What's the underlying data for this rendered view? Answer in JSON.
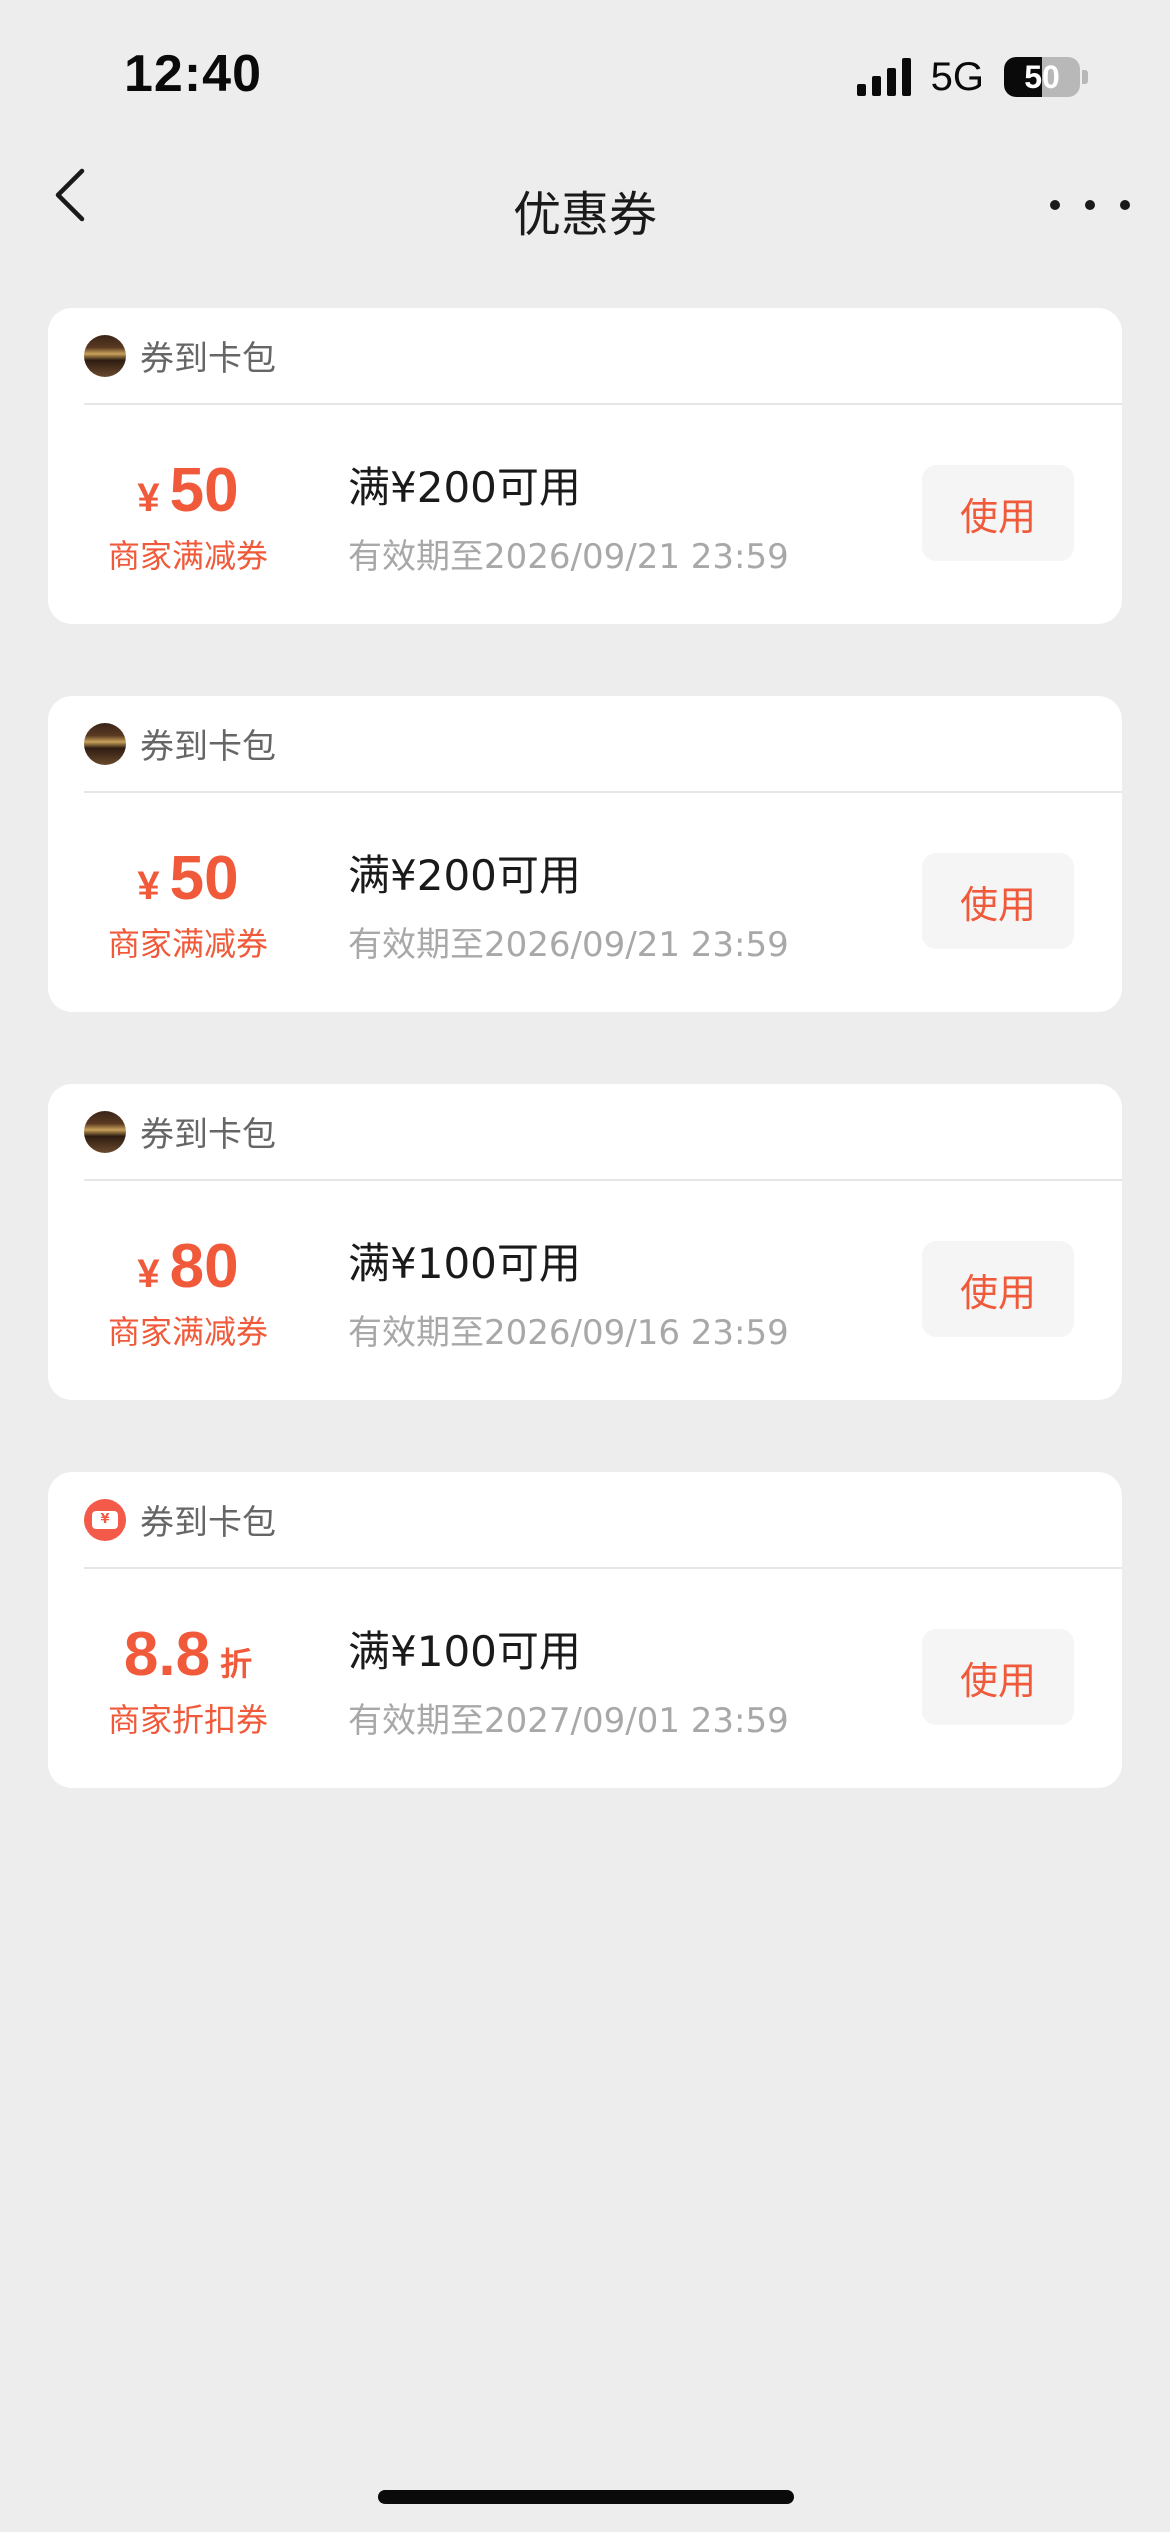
{
  "status_bar": {
    "time": "12:40",
    "network": "5G",
    "battery_level": "50",
    "battery_fraction": 0.5
  },
  "nav": {
    "back_icon": "chevron-left-icon",
    "title": "优惠券",
    "more_icon": "ellipsis-icon"
  },
  "coupons": [
    {
      "source": "券到卡包",
      "avatar": "store-avatar",
      "currency": "¥",
      "amount": "50",
      "unit": "",
      "type": "商家满减券",
      "condition": "满¥200可用",
      "validity": "有效期至2026/09/21 23:59",
      "action": "使用"
    },
    {
      "source": "券到卡包",
      "avatar": "store-avatar",
      "currency": "¥",
      "amount": "50",
      "unit": "",
      "type": "商家满减券",
      "condition": "满¥200可用",
      "validity": "有效期至2026/09/21 23:59",
      "action": "使用"
    },
    {
      "source": "券到卡包",
      "avatar": "store-avatar",
      "currency": "¥",
      "amount": "80",
      "unit": "",
      "type": "商家满减券",
      "condition": "满¥100可用",
      "validity": "有效期至2026/09/16 23:59",
      "action": "使用"
    },
    {
      "source": "券到卡包",
      "avatar": "coupon-wallet-icon",
      "currency": "",
      "amount": "8.8",
      "unit": "折",
      "type": "商家折扣券",
      "condition": "满¥100可用",
      "validity": "有效期至2027/09/01 23:59",
      "action": "使用"
    }
  ],
  "colors": {
    "accent": "#f05a3a",
    "background": "#ededed",
    "card": "#ffffff",
    "muted_text": "#a8a8a8"
  }
}
